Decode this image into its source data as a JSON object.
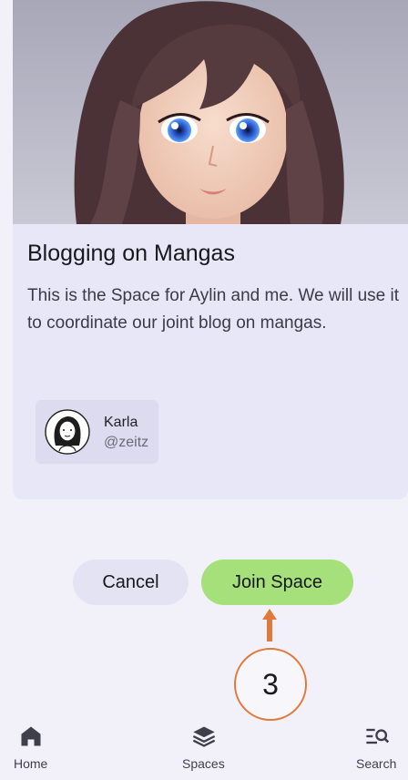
{
  "space": {
    "title": "Blogging on Mangas",
    "description": "This is the Space for Aylin and me. We will use it to coordinate our joint blog on mangas."
  },
  "member": {
    "name": "Karla",
    "handle": "@zeitz"
  },
  "actions": {
    "cancel_label": "Cancel",
    "join_label": "Join Space"
  },
  "annotation": {
    "step_number": "3"
  },
  "nav": {
    "home_label": "Home",
    "spaces_label": "Spaces",
    "search_label": "Search"
  },
  "colors": {
    "join_button": "#a6e07a",
    "cancel_button": "#e4e3f4",
    "annotation": "#e07a3a"
  },
  "icons": {
    "home": "home-icon",
    "spaces": "layers-icon",
    "search": "search-list-icon"
  }
}
